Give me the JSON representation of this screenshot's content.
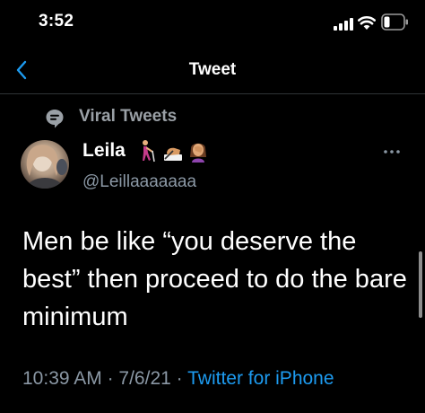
{
  "status_bar": {
    "time": "3:52",
    "icons": [
      "signal-icon",
      "wifi-icon",
      "battery-icon"
    ]
  },
  "nav": {
    "title": "Tweet",
    "back_icon": "chevron-left-icon"
  },
  "context": {
    "icon": "chat-bubble-icon",
    "label": "Viral Tweets"
  },
  "author": {
    "name": "Leila",
    "handle": "@Leillaaaaaaa",
    "emojis": [
      "person-with-cane-emoji",
      "writing-hand-emoji",
      "woman-facepalming-emoji"
    ]
  },
  "tweet": {
    "text": "Men be like “you deserve the best” then proceed to do the bare minimum"
  },
  "meta": {
    "time": "10:39 AM",
    "separator": "·",
    "date": "7/6/21",
    "source": "Twitter for iPhone"
  },
  "colors": {
    "background": "#000000",
    "link": "#1d9bf0",
    "muted": "#8b98a5",
    "divider": "#2f3336"
  }
}
